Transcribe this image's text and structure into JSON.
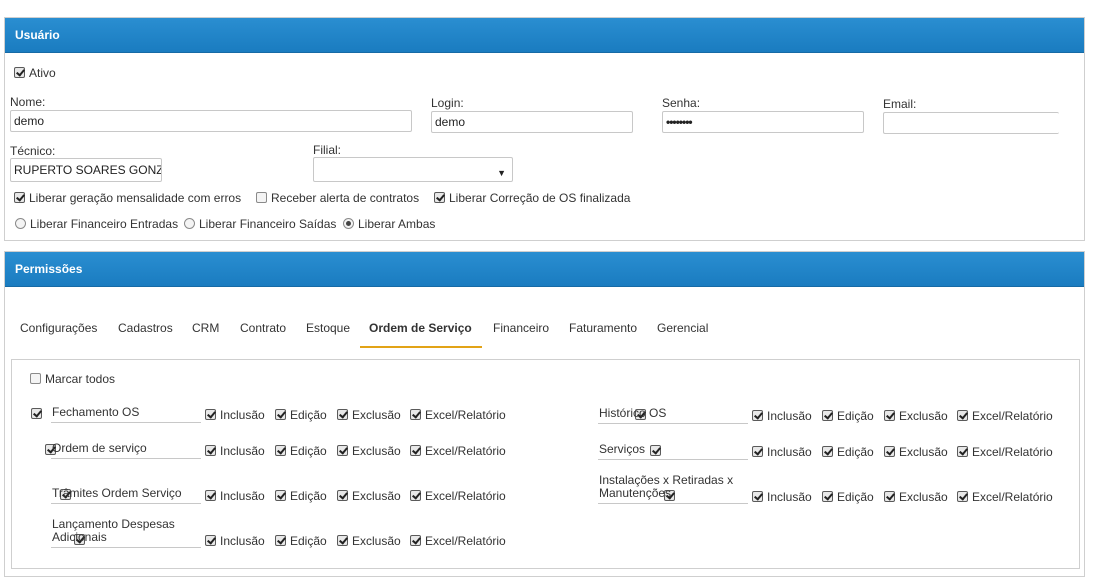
{
  "usuario": {
    "title": "Usuário",
    "ativo_label": "Ativo",
    "nome_label": "Nome:",
    "nome_value": "demo",
    "login_label": "Login:",
    "login_value": "demo",
    "senha_label": "Senha:",
    "senha_value": "••••••••",
    "email_label": "Email:",
    "email_value": "",
    "tecnico_label": "Técnico:",
    "tecnico_value": "RUPERTO SOARES GONZ",
    "filial_label": "Filial:",
    "filial_value": "",
    "checks": [
      {
        "label": "Liberar geração mensalidade com erros",
        "checked": true
      },
      {
        "label": "Receber alerta de contratos",
        "checked": false
      },
      {
        "label": "Liberar Correção de OS finalizada",
        "checked": true
      }
    ],
    "radios": [
      {
        "label": "Liberar Financeiro Entradas",
        "checked": false
      },
      {
        "label": "Liberar Financeiro Saídas",
        "checked": false
      },
      {
        "label": "Liberar Ambas",
        "checked": true
      }
    ]
  },
  "permissoes": {
    "title": "Permissões",
    "tabs": [
      "Configurações",
      "Cadastros",
      "CRM",
      "Contrato",
      "Estoque",
      "Ordem de Serviço",
      "Financeiro",
      "Faturamento",
      "Gerencial"
    ],
    "active_tab": "Ordem de Serviço",
    "marcar_todos": "Marcar todos",
    "perm_labels": [
      "Inclusão",
      "Edição",
      "Exclusão",
      "Excel/Relatório"
    ],
    "left_items": [
      {
        "name": "Fechamento OS"
      },
      {
        "name": "Ordem de serviço"
      },
      {
        "name": "Trâmites Ordem Serviço"
      },
      {
        "name": "Lançamento Despesas Adicionais"
      }
    ],
    "right_items": [
      {
        "name": "Histórico OS"
      },
      {
        "name": "Serviços"
      },
      {
        "name": "Instalações x Retiradas x Manutenções"
      }
    ]
  }
}
